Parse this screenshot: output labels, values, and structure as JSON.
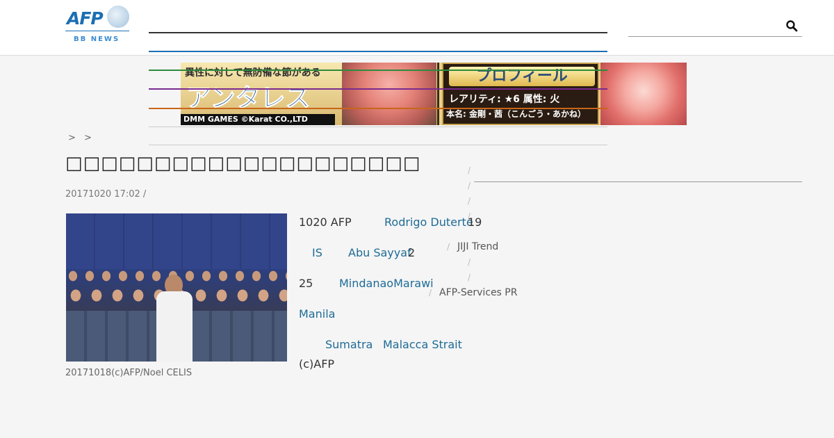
{
  "logo": {
    "brand": "AFP",
    "sub": "BB NEWS"
  },
  "search": {
    "value": "",
    "placeholder": ""
  },
  "ad": {
    "top_text": "異性に対して無防備な節がある",
    "title": "アンタレス",
    "footer": "DMM GAMES ©Karat CO.,LTD",
    "profile": "プロフィール",
    "rarity_line": "レアリティ: ★6  属性: 火",
    "name_line": "本名: 金剛・茜（こんごう・あかね）",
    "stripe_colors": [
      "#2e8b3d",
      "#7b2a8f",
      "#c9661a"
    ]
  },
  "breadcrumb": {
    "text": "> >"
  },
  "article": {
    "title": "□□□□□□□□□□□□□□□□□□□□",
    "date": "20171020 17:02  /",
    "photo_caption": "20171018(c)AFP/Noel CELIS",
    "body": {
      "p1_lead": "1020 AFP",
      "p1_link": "Rodrigo Duterte",
      "p1_tail": "19",
      "p2_link1": "IS",
      "p2_link2": "Abu Sayyaf",
      "p2_tail": "2",
      "p3_lead": "25",
      "p3_link": "MindanaoMarawi",
      "p4_link": "Manila",
      "p5_link1": "Sumatra",
      "p5_link2": "Malacca Strait",
      "credit": "(c)AFP"
    }
  },
  "sidebar": {
    "slash": "/",
    "jiji": "JIJI Trend",
    "afp_services": "AFP-Services PR"
  }
}
